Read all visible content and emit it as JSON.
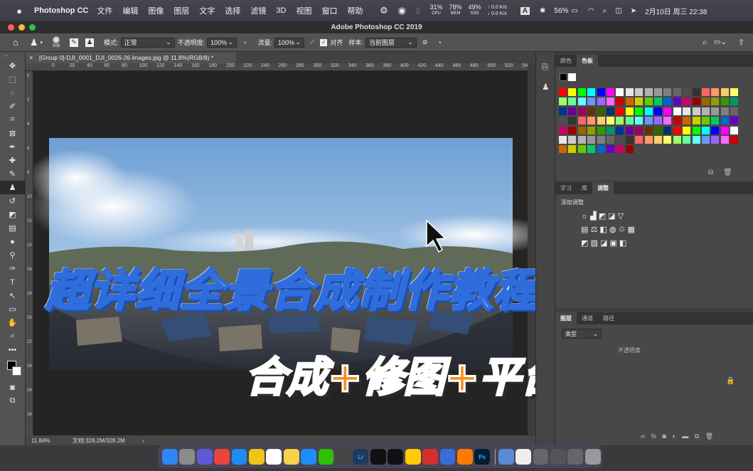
{
  "menubar": {
    "apple": "",
    "app": "Photoshop CC",
    "items": [
      "文件",
      "编辑",
      "图像",
      "图层",
      "文字",
      "选择",
      "滤镜",
      "3D",
      "视图",
      "窗口",
      "帮助"
    ],
    "stats": [
      {
        "v": "31%",
        "l": "CPU"
      },
      {
        "v": "78%",
        "l": "MEM"
      },
      {
        "v": "49%",
        "l": "SSD"
      }
    ],
    "net": [
      "↑ 0.0 K/s",
      "↓ 0.0 K/s"
    ],
    "input": "A",
    "battery": "56%",
    "datetime": "2月10日 周三 22:38"
  },
  "window": {
    "title": "Adobe Photoshop CC 2019"
  },
  "options": {
    "brush_size": "508",
    "mode_label": "模式:",
    "mode_value": "正常",
    "opacity_label": "不透明度:",
    "opacity_value": "100%",
    "flow_label": "流量:",
    "flow_value": "100%",
    "align_label": "对齐",
    "sample_label": "样本:",
    "sample_value": "当前图层"
  },
  "document": {
    "tab": "[Group 0]-DJI_0001_DJI_0026-26 images.jpg @ 11.8%(RGB/8) *",
    "zoom": "11.84%",
    "docinfo": "文档:328.2M/328.2M"
  },
  "ruler": {
    "top": [
      "0",
      "20",
      "40",
      "60",
      "80",
      "100",
      "120",
      "140",
      "160",
      "180",
      "200",
      "220",
      "240",
      "260",
      "280",
      "300",
      "320",
      "340",
      "360",
      "380",
      "400",
      "420",
      "440",
      "460",
      "480",
      "500",
      "520",
      "540"
    ],
    "left": [
      "0",
      "2",
      "4",
      "6",
      "8",
      "10",
      "12",
      "14",
      "16",
      "18",
      "20",
      "22",
      "24",
      "26",
      "28"
    ]
  },
  "overlay": {
    "title": "超详细全景合成制作教程",
    "subtitle": "合成+修图+平台上传"
  },
  "panels": {
    "color_tabs": [
      "颜色",
      "色板"
    ],
    "adjust_tabs": [
      "学习",
      "库",
      "调整"
    ],
    "adjust_label": "添加调整",
    "layers_tabs": [
      "图层",
      "通道",
      "路径"
    ],
    "layers_filter": "类型",
    "layers_opacity": "不透明度"
  },
  "swatches": [
    "#ff0000",
    "#ffff00",
    "#00ff00",
    "#00ffff",
    "#0000ff",
    "#ff00ff",
    "#ffffff",
    "#e6e6e6",
    "#cccccc",
    "#b3b3b3",
    "#999999",
    "#808080",
    "#666666",
    "#4d4d4d",
    "#333333",
    "#ff6666",
    "#ff9966",
    "#ffcc66",
    "#ffff66",
    "#99ff66",
    "#66ff99",
    "#66ffff",
    "#6699ff",
    "#9966ff",
    "#ff66ff",
    "#cc0000",
    "#cc6600",
    "#cccc00",
    "#66cc00",
    "#00cc66",
    "#0066cc",
    "#6600cc",
    "#cc0066",
    "#990000",
    "#996600",
    "#999900",
    "#339900",
    "#009966",
    "#003399",
    "#660099",
    "#990066",
    "#663300",
    "#336600",
    "#003366"
  ],
  "dock": {
    "items": [
      "Finder",
      "Launchpad",
      "Siri",
      "Chrome",
      "Safari",
      "Tips",
      "Calendar",
      "Notes",
      "App Store",
      "WeChat",
      "Final Cut",
      "Lr",
      "CapCut",
      "QQ",
      "Kugou",
      "WPS",
      "Baidu",
      "Kwai",
      "Ps",
      "Prefs",
      "Docs",
      "Window1",
      "Window2",
      "Window3",
      "Trash"
    ]
  },
  "colors": {
    "menubar": "#3b3c45",
    "panel": "#535353",
    "canvas": "#242424",
    "title_blue": "#2f6ddc",
    "title_orange": "#f58f23"
  }
}
